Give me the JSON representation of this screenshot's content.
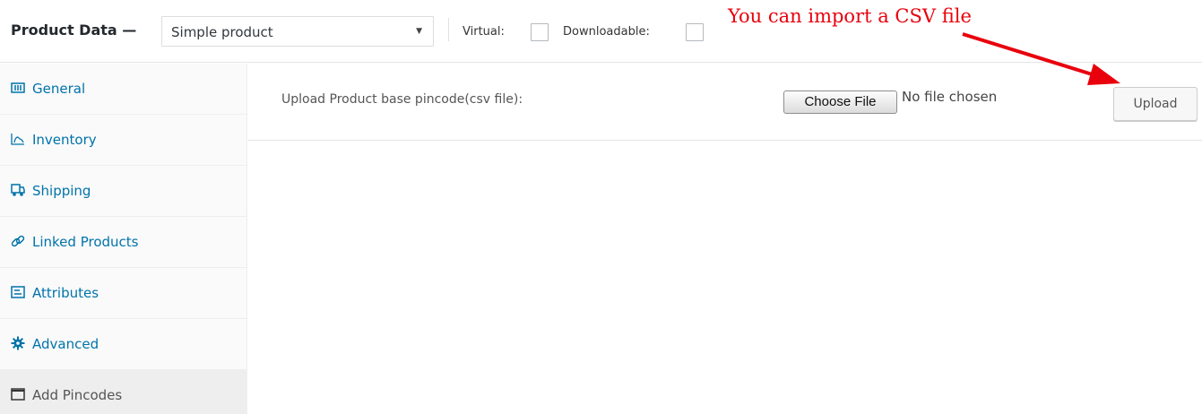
{
  "header": {
    "title": "Product Data —",
    "product_type": "Simple product",
    "virtual_label": "Virtual:",
    "downloadable_label": "Downloadable:",
    "annotation": "You can import a CSV file"
  },
  "sidebar": {
    "items": [
      {
        "label": "General",
        "icon": "general-icon"
      },
      {
        "label": "Inventory",
        "icon": "inventory-icon"
      },
      {
        "label": "Shipping",
        "icon": "shipping-icon"
      },
      {
        "label": "Linked Products",
        "icon": "link-icon"
      },
      {
        "label": "Attributes",
        "icon": "attributes-icon"
      },
      {
        "label": "Advanced",
        "icon": "gear-icon"
      },
      {
        "label": "Add Pincodes",
        "icon": "window-icon",
        "active": true
      }
    ]
  },
  "main": {
    "upload_label": "Upload Product base pincode(csv file):",
    "choose_file_label": "Choose File",
    "no_file_text": "No file chosen",
    "upload_button": "Upload"
  },
  "colors": {
    "link": "#0073aa",
    "annotation": "#e8000c"
  }
}
